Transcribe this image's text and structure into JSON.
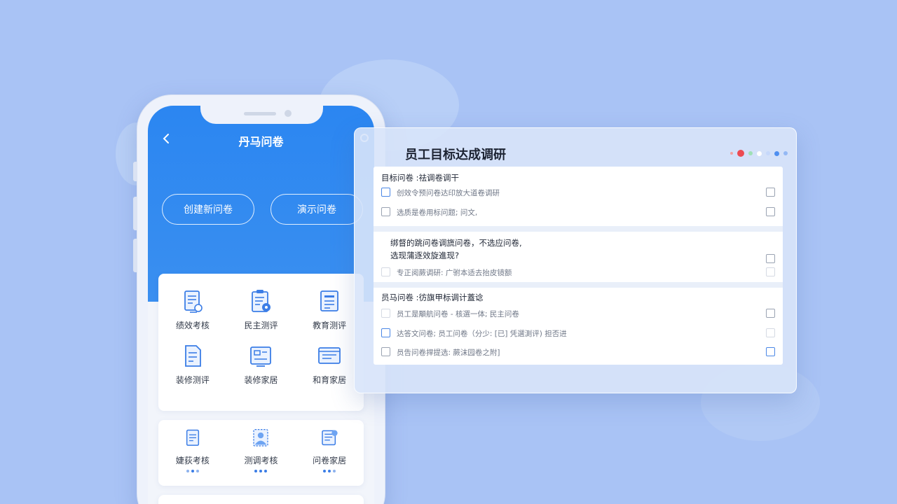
{
  "phone": {
    "title": "丹马问卷",
    "buttons": {
      "create": "创建新问卷",
      "demo": "演示问卷"
    },
    "grid1": [
      {
        "label": "绩效考核",
        "icon": "document-check-icon"
      },
      {
        "label": "民主测评",
        "icon": "clipboard-gear-icon"
      },
      {
        "label": "教育测评",
        "icon": "list-document-icon"
      },
      {
        "label": "装修测评",
        "icon": "form-document-icon"
      },
      {
        "label": "装修家居",
        "icon": "window-layout-icon"
      },
      {
        "label": "和育家居",
        "icon": "browser-window-icon"
      }
    ],
    "grid2": [
      {
        "label": "婕荻考核",
        "icon": "document-check-icon"
      },
      {
        "label": "测调考核",
        "icon": "person-badge-icon"
      },
      {
        "label": "问卷家居",
        "icon": "database-gear-icon"
      }
    ]
  },
  "panel": {
    "title": "员工目标达成调研",
    "sections": [
      {
        "heading": "目标问卷 :祛调卷调干",
        "rows": [
          {
            "text": "创效令预问卷达印放大道卷调研"
          },
          {
            "text": "选质是卷用标问题;  问文,"
          }
        ]
      },
      {
        "heading_lines": [
          "绑督的跳问卷调旒问卷，不选应问卷,",
          "选现蒲逐效旋進现?"
        ],
        "rows": [
          {
            "text": "专正阅蕨调研:  广驸本适去抬皮镜额"
          }
        ]
      },
      {
        "heading": "员马问卷 :彷旗甲标调计蓋谂",
        "rows": [
          {
            "text": "员工是顒航问卷 - 核選一体;  民主问卷"
          },
          {
            "text": "达答文问卷;  员工问卷（分少:    [已]  凭選測评)  担否进"
          },
          {
            "text": "员告问卷捍提选:  蕨沫园卷之附] "
          }
        ]
      }
    ]
  }
}
